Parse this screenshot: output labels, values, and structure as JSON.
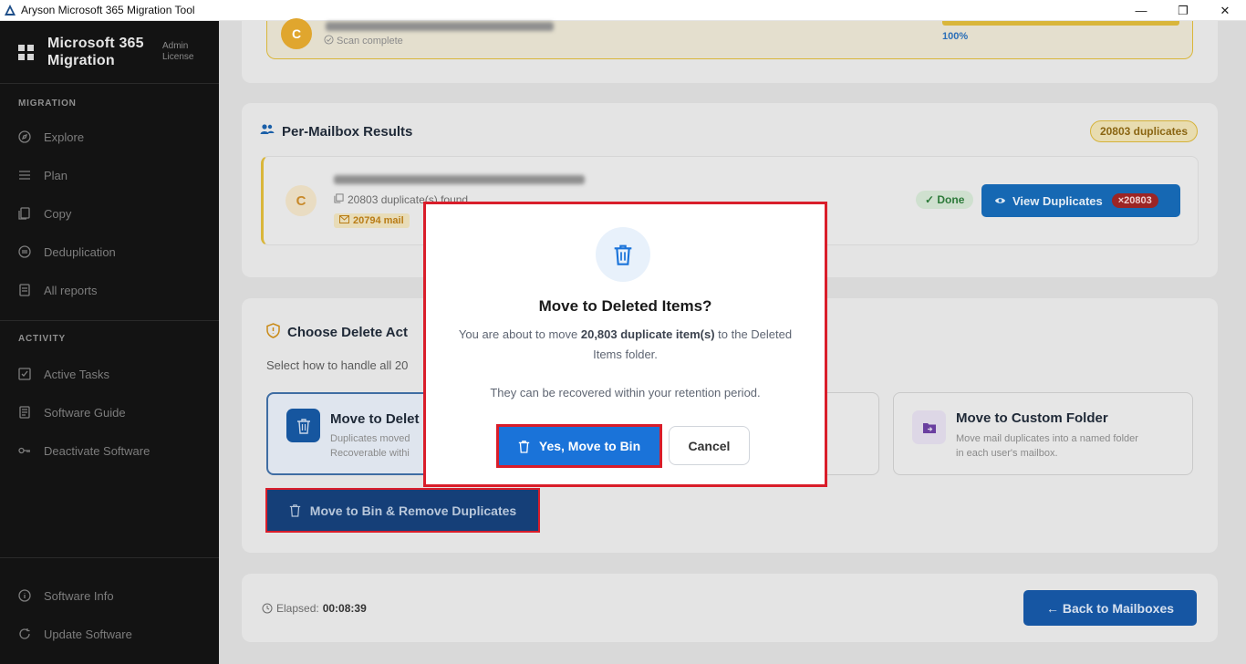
{
  "window": {
    "title": "Aryson Microsoft 365 Migration Tool",
    "controls": [
      "—",
      "❐",
      "✕"
    ]
  },
  "sidebar": {
    "brand_name": "Microsoft 365 Migration",
    "license": "Admin License",
    "section_migration": "MIGRATION",
    "migration_items": [
      {
        "label": "Explore",
        "icon": "compass-icon"
      },
      {
        "label": "Plan",
        "icon": "list-icon"
      },
      {
        "label": "Copy",
        "icon": "copy-icon"
      },
      {
        "label": "Deduplication",
        "icon": "dedup-icon"
      },
      {
        "label": "All reports",
        "icon": "report-icon"
      }
    ],
    "section_activity": "ACTIVITY",
    "activity_items": [
      {
        "label": "Active Tasks",
        "icon": "checkbox-icon"
      },
      {
        "label": "Software Guide",
        "icon": "guide-icon"
      },
      {
        "label": "Deactivate Software",
        "icon": "key-icon"
      }
    ],
    "bottom_items": [
      {
        "label": "Software Info",
        "icon": "info-icon"
      },
      {
        "label": "Update Software",
        "icon": "refresh-icon"
      }
    ]
  },
  "scan": {
    "avatar_letter": "C",
    "status": "Scan complete",
    "progress_text": "100%",
    "progress": 1.0
  },
  "results": {
    "title": "Per-Mailbox Results",
    "total_badge": "20803 duplicates",
    "row": {
      "avatar_letter": "C",
      "duplicates_text": "20803 duplicate(s) found",
      "mail_badge": "20794 mail",
      "status": "✓ Done",
      "view_button": "View Duplicates",
      "view_count": "×20803"
    }
  },
  "delete_action": {
    "title": "Choose Delete Act",
    "subtitle": "Select how to handle all 20",
    "options": [
      {
        "title": "Move to Delet",
        "desc_line1": "Duplicates moved",
        "desc_line2": "Recoverable withi"
      },
      {
        "title": "Move to Custom Folder",
        "desc_line1": "Move mail duplicates into a named folder",
        "desc_line2": "in each user's mailbox."
      }
    ],
    "remove_button": "Move to Bin & Remove Duplicates"
  },
  "footer": {
    "elapsed_label": "Elapsed:",
    "elapsed_value": "00:08:39",
    "back_button": "← Back to Mailboxes"
  },
  "modal": {
    "title": "Move to Deleted Items?",
    "body_pre": "You are about to move ",
    "body_bold": "20,803 duplicate item(s)",
    "body_post": " to the Deleted Items folder.",
    "note": "They can be recovered within your retention period.",
    "confirm_button": "Yes, Move to Bin",
    "cancel_button": "Cancel"
  },
  "colors": {
    "accent": "#1a73d9",
    "highlight": "#d91d2a",
    "warning": "#e0a62e"
  }
}
